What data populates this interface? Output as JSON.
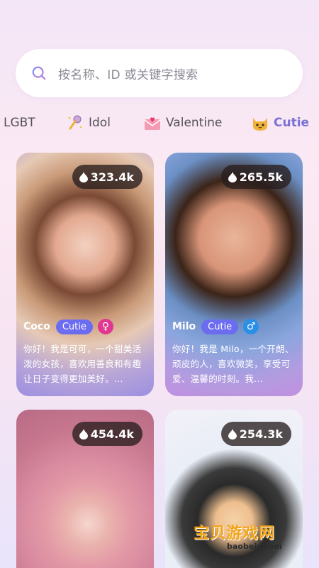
{
  "search": {
    "placeholder": "按名称、ID 或关键字搜索"
  },
  "tabs": [
    {
      "label": "LGBT",
      "icon": "rainbow-icon"
    },
    {
      "label": "Idol",
      "icon": "microphone-icon"
    },
    {
      "label": "Valentine",
      "icon": "love-letter-icon"
    },
    {
      "label": "Cutie",
      "icon": "cat-face-icon",
      "active": true
    }
  ],
  "cards": [
    {
      "name": "Coco",
      "tag": "Cutie",
      "gender": "female",
      "gender_symbol": "♀",
      "count": "323.4k",
      "desc": "你好！我是可可，一个甜美活泼的女孩，喜欢用善良和有趣让日子变得更加美好。..."
    },
    {
      "name": "Milo",
      "tag": "Cutie",
      "gender": "male",
      "gender_symbol": "♂",
      "count": "265.5k",
      "desc": "你好！我是 Milo，一个开朗、顽皮的人，喜欢微笑，享受可爱、温馨的时刻。我..."
    },
    {
      "count": "454.4k"
    },
    {
      "count": "254.3k"
    }
  ],
  "watermark": {
    "title": "宝贝游戏网",
    "url": "baobeiy.com"
  },
  "colors": {
    "accent": "#6b6cf0",
    "female": "#e0368f",
    "male": "#2a8fe6"
  }
}
